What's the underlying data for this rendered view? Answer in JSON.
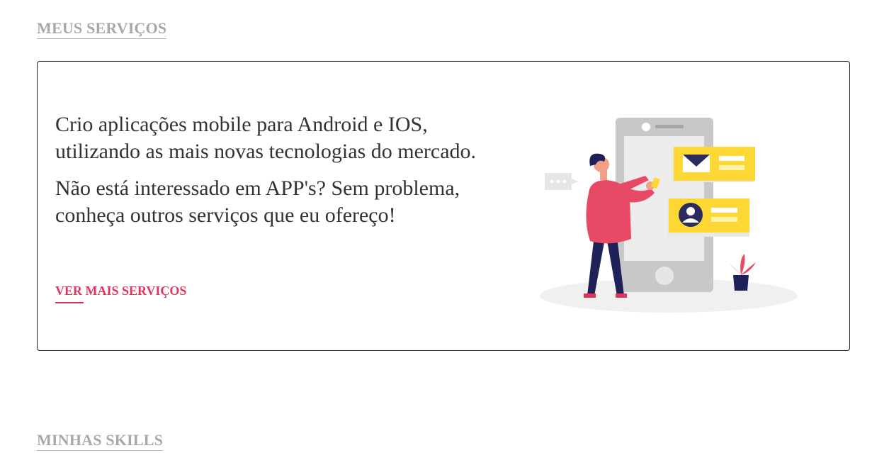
{
  "services_section": {
    "heading": "MEUS SERVIÇOS",
    "card": {
      "paragraph_1": "Crio aplicações mobile para Android e IOS, utilizando as mais novas tecnologias do mercado.",
      "paragraph_2": "Não está interessado em APP's? Sem problema, conheça outros serviços que eu ofereço!",
      "link_label": "VER MAIS SERVIÇOS",
      "illustration": "mobile-app-developer-illustration"
    }
  },
  "skills_section": {
    "heading": "MINHAS SKILLS"
  },
  "colors": {
    "accent": "#e0355a",
    "heading_gray": "#a8a8a8",
    "text": "#333333",
    "illustration_yellow": "#fdd835",
    "illustration_navy": "#2b2b5e"
  }
}
